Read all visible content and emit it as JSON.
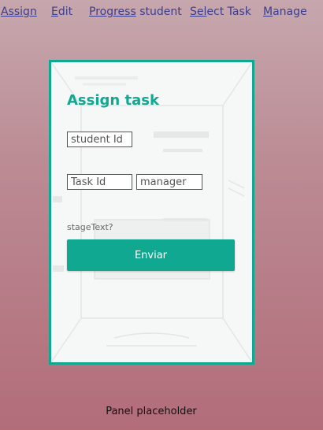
{
  "nav": {
    "items": [
      {
        "id": "assign",
        "prefix": "",
        "underlined": "Assign",
        "suffix": ""
      },
      {
        "id": "edit",
        "prefix": "",
        "underlined": "E",
        "suffix": "dit"
      },
      {
        "id": "progress",
        "prefix": "",
        "underlined": "Progress",
        "suffix": " student"
      },
      {
        "id": "select",
        "prefix": "",
        "underlined": "Sel",
        "suffix": "ect Task"
      },
      {
        "id": "manage",
        "prefix": "",
        "underlined": "M",
        "suffix": "anage"
      }
    ]
  },
  "panel": {
    "title": "Assign task",
    "student_placeholder": "student Id",
    "task_placeholder": "Task Id",
    "manager_placeholder": "manager",
    "stage_text": "stageText?",
    "submit_label": "Enviar"
  },
  "footer": {
    "placeholder_text": "Panel placeholder"
  },
  "colors": {
    "accent": "#11a892",
    "nav_link": "#3a3d8f",
    "background_top": "#c6a7ad",
    "background_bottom": "#b26d79"
  }
}
